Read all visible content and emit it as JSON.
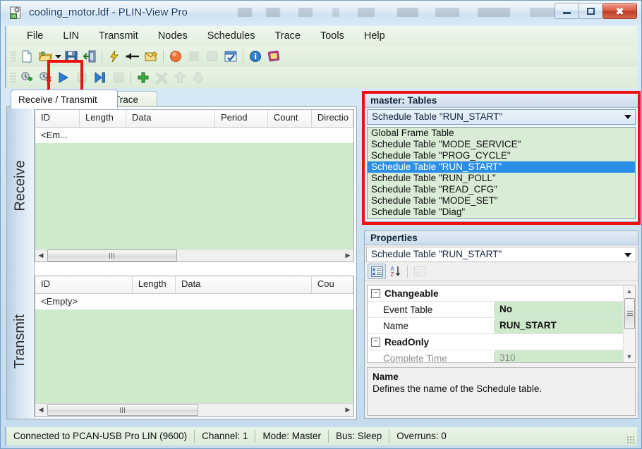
{
  "window": {
    "title_file": "cooling_motor.ldf",
    "title_sep": " - ",
    "title_app": "PLIN-View Pro",
    "icon": "lin-document-icon",
    "buttons": {
      "minimize": "minimize-button",
      "maximize": "maximize-button",
      "close": "✖"
    }
  },
  "menu": {
    "items": [
      {
        "label": "File"
      },
      {
        "label": "LIN"
      },
      {
        "label": "Transmit"
      },
      {
        "label": "Nodes"
      },
      {
        "label": "Schedules"
      },
      {
        "label": "Trace"
      },
      {
        "label": "Tools"
      },
      {
        "label": "Help"
      }
    ]
  },
  "toolbar_row1": [
    {
      "name": "new-file-icon",
      "enabled": true
    },
    {
      "name": "open-file-icon",
      "enabled": true
    },
    {
      "name": "open-dropdown-icon",
      "enabled": true
    },
    {
      "name": "save-file-icon",
      "enabled": true
    },
    {
      "name": "export-icon",
      "enabled": true
    },
    {
      "name": "separator",
      "enabled": true
    },
    {
      "name": "connect-icon",
      "enabled": true
    },
    {
      "name": "disconnect-icon",
      "enabled": true
    },
    {
      "name": "mail-icon",
      "enabled": true
    },
    {
      "name": "separator",
      "enabled": true
    },
    {
      "name": "record-icon",
      "enabled": true
    },
    {
      "name": "pause-icon",
      "enabled": false
    },
    {
      "name": "stop-icon",
      "enabled": false
    },
    {
      "name": "checked-window-icon",
      "enabled": true
    },
    {
      "name": "separator",
      "enabled": true
    },
    {
      "name": "info-icon",
      "enabled": true
    },
    {
      "name": "help-book-icon",
      "enabled": true
    }
  ],
  "toolbar_row2": [
    {
      "name": "add-schedule-icon",
      "enabled": true
    },
    {
      "name": "delete-schedule-icon",
      "enabled": true
    },
    {
      "name": "play-schedule-icon",
      "enabled": true
    },
    {
      "name": "pause-schedule-icon",
      "enabled": false
    },
    {
      "name": "step-schedule-icon",
      "enabled": true
    },
    {
      "name": "stop-schedule-icon",
      "enabled": false
    },
    {
      "name": "separator",
      "enabled": true
    },
    {
      "name": "add-entry-icon",
      "enabled": true
    },
    {
      "name": "delete-entry-icon",
      "enabled": false
    },
    {
      "name": "move-up-icon",
      "enabled": false
    },
    {
      "name": "move-down-icon",
      "enabled": false
    }
  ],
  "tabs": [
    {
      "label": "Receive / Transmit",
      "active": true
    },
    {
      "label": "Trace",
      "active": false
    }
  ],
  "receive": {
    "side_label": "Receive",
    "columns": [
      "ID",
      "Length",
      "Data",
      "Period",
      "Count",
      "Directio"
    ],
    "empty_row": "<Em..."
  },
  "transmit": {
    "side_label": "Transmit",
    "columns": [
      "ID",
      "Length",
      "Data",
      "Cou"
    ],
    "empty_row": "<Empty>"
  },
  "tables_panel": {
    "caption": "master: Tables",
    "selected": "Schedule Table \"RUN_START\"",
    "options": [
      {
        "label": "Global Frame Table",
        "selected": false
      },
      {
        "label": "Schedule Table \"MODE_SERVICE\"",
        "selected": false
      },
      {
        "label": "Schedule Table \"PROG_CYCLE\"",
        "selected": false
      },
      {
        "label": "Schedule Table \"RUN_START\"",
        "selected": true
      },
      {
        "label": "Schedule Table \"RUN_POLL\"",
        "selected": false
      },
      {
        "label": "Schedule Table \"READ_CFG\"",
        "selected": false
      },
      {
        "label": "Schedule Table \"MODE_SET\"",
        "selected": false
      },
      {
        "label": "Schedule Table \"Diag\"",
        "selected": false
      }
    ]
  },
  "properties_panel": {
    "caption": "Properties",
    "selected_object": "Schedule Table \"RUN_START\"",
    "toolbar": {
      "categorized": "categorized-view-button",
      "alphabetical": "alphabetical-sort-button",
      "property_pages": "property-pages-button"
    },
    "groups": [
      {
        "name": "Changeable",
        "expander": "−",
        "rows": [
          {
            "name": "Event Table",
            "value": "No",
            "readonly": false
          },
          {
            "name": "Name",
            "value": "RUN_START",
            "readonly": false
          }
        ]
      },
      {
        "name": "ReadOnly",
        "expander": "−",
        "rows": [
          {
            "name": "Complete Time",
            "value": "310",
            "readonly": true
          }
        ]
      }
    ],
    "description": {
      "title": "Name",
      "text": "Defines the name of the Schedule table."
    }
  },
  "statusbar": {
    "cells": [
      "Connected to PCAN-USB Pro LIN (9600)",
      "Channel: 1",
      "Mode: Master",
      "Bus: Sleep",
      "Overruns: 0"
    ]
  },
  "annotations": [
    {
      "name": "play-button-highlight"
    },
    {
      "name": "tables-panel-highlight"
    }
  ],
  "colors": {
    "accent_blue": "#2a8ee6",
    "panel_green": "#cfe9cd",
    "annotation_red": "#ee1111",
    "title_text": "#1b3f73"
  }
}
